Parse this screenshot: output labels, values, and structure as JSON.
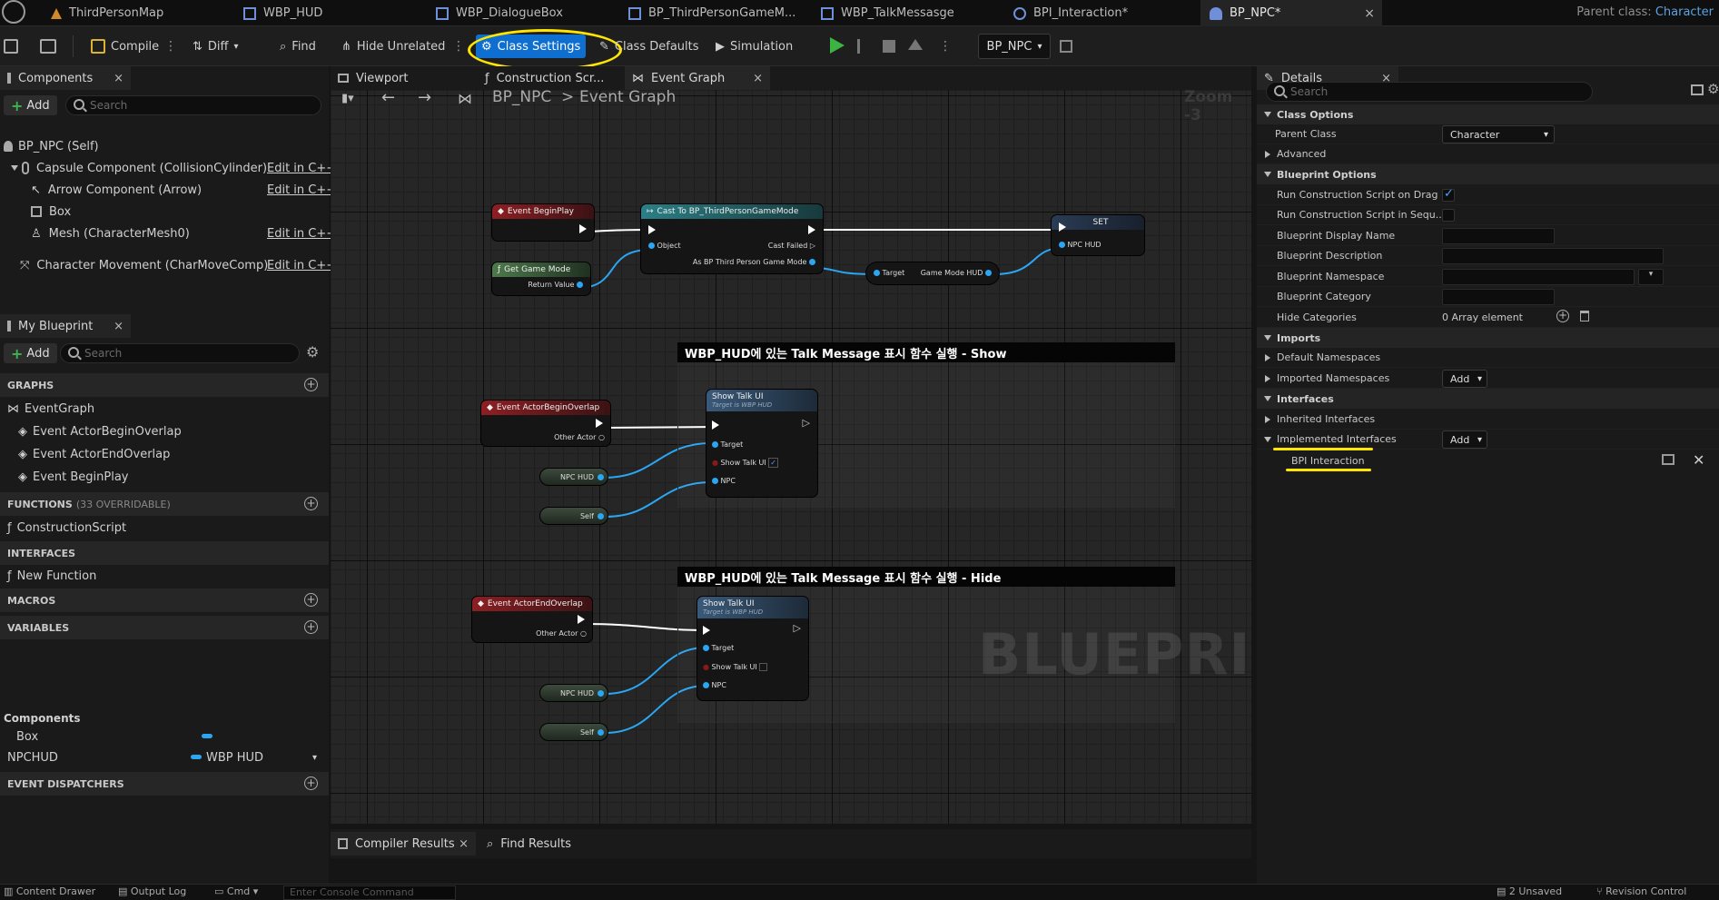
{
  "doc_tabs": [
    {
      "label": "ThirdPersonMap",
      "icon": "level-icon"
    },
    {
      "label": "WBP_HUD",
      "icon": "widget-blueprint-icon"
    },
    {
      "label": "WBP_DialogueBox",
      "icon": "widget-blueprint-icon"
    },
    {
      "label": "BP_ThirdPersonGameM...",
      "icon": "blueprint-icon"
    },
    {
      "label": "WBP_TalkMessasge",
      "icon": "widget-blueprint-icon"
    },
    {
      "label": "BPI_Interaction*",
      "icon": "interface-icon"
    },
    {
      "label": "BP_NPC*",
      "icon": "character-blueprint-icon",
      "active": true,
      "close": "×"
    }
  ],
  "parent_class": {
    "label": "Parent class:",
    "value": "Character"
  },
  "toolbar": {
    "compile": "Compile",
    "diff": "Diff",
    "find": "Find",
    "hide_unrelated": "Hide Unrelated",
    "class_settings": "Class Settings",
    "class_defaults": "Class Defaults",
    "simulation": "Simulation",
    "debug_object": "BP_NPC"
  },
  "components_panel": {
    "title": "Components",
    "close": "×",
    "add": "Add",
    "search_placeholder": "Search",
    "items": [
      {
        "label": "BP_NPC (Self)",
        "edit": ""
      },
      {
        "label": "Capsule Component (CollisionCylinder)",
        "edit": "Edit in C++"
      },
      {
        "label": "Arrow Component (Arrow)",
        "edit": "Edit in C++"
      },
      {
        "label": "Box",
        "edit": ""
      },
      {
        "label": "Mesh (CharacterMesh0)",
        "edit": "Edit in C++"
      },
      {
        "label": "Character Movement (CharMoveComp)",
        "edit": "Edit in C++"
      }
    ]
  },
  "my_blueprint": {
    "title": "My Blueprint",
    "close": "×",
    "add": "Add",
    "search_placeholder": "Search",
    "graphs_header": "GRAPHS",
    "graphs": [
      "EventGraph",
      "Event ActorBeginOverlap",
      "Event ActorEndOverlap",
      "Event BeginPlay"
    ],
    "functions_header": "FUNCTIONS",
    "functions_sub": "(33 OVERRIDABLE)",
    "functions": [
      "ConstructionScript"
    ],
    "interfaces_header": "INTERFACES",
    "interfaces": [
      "New Function"
    ],
    "macros_header": "MACROS",
    "variables_header": "VARIABLES",
    "variables_group": "Components",
    "variables": [
      {
        "name": "Box",
        "type": ""
      },
      {
        "name": "NPCHUD",
        "type": "WBP HUD"
      }
    ],
    "dispatchers_header": "EVENT DISPATCHERS"
  },
  "graph_tabs": {
    "viewport": "Viewport",
    "construction": "Construction Scr...",
    "event_graph": "Event Graph",
    "close": "×"
  },
  "breadcrumb": {
    "root": "BP_NPC",
    "sep": ">",
    "current": "Event Graph",
    "zoom": "Zoom -3"
  },
  "nodes": {
    "begin_play": "Event BeginPlay",
    "cast": "Cast To BP_ThirdPersonGameMode",
    "cast_object": "Object",
    "cast_failed": "Cast Failed",
    "cast_as": "As BP Third Person Game Mode",
    "get_game_mode": "Get Game Mode",
    "return_value": "Return Value",
    "target": "Target",
    "game_mode_hud": "Game Mode HUD",
    "set": "SET",
    "npc_hud": "NPC HUD",
    "comment_show": "WBP_HUD에 있는 Talk Message 표시 함수 실행 - Show",
    "comment_hide": "WBP_HUD에 있는 Talk Message 표시 함수 실행 - Hide",
    "begin_overlap": "Event ActorBeginOverlap",
    "end_overlap": "Event ActorEndOverlap",
    "other_actor": "Other Actor",
    "show_talk_ui": "Show Talk UI",
    "target_is": "Target is WBP HUD",
    "show_talk_ui_pin": "Show Talk UI",
    "npc": "NPC",
    "self": "Self"
  },
  "watermark": "BLUEPRINT",
  "bottom_tabs": {
    "compiler_results": "Compiler Results",
    "close": "×",
    "find_results": "Find Results"
  },
  "details": {
    "title": "Details",
    "close": "×",
    "search_placeholder": "Search",
    "class_options": "Class Options",
    "parent_class_label": "Parent Class",
    "parent_class_value": "Character",
    "advanced": "Advanced",
    "blueprint_options": "Blueprint Options",
    "run_on_drag": "Run Construction Script on Drag",
    "run_on_drag_checked": true,
    "run_in_seq": "Run Construction Script in Sequ...",
    "run_in_seq_checked": false,
    "display_name": "Blueprint Display Name",
    "description": "Blueprint Description",
    "namespace": "Blueprint Namespace",
    "category": "Blueprint Category",
    "hide_categories": "Hide Categories",
    "hide_categories_value": "0 Array element",
    "imports": "Imports",
    "default_namespaces": "Default Namespaces",
    "imported_namespaces": "Imported Namespaces",
    "add": "Add",
    "interfaces": "Interfaces",
    "inherited": "Inherited Interfaces",
    "implemented": "Implemented Interfaces",
    "bpi_entry": "BPI Interaction"
  },
  "statusbar": {
    "content_drawer": "Content Drawer",
    "output_log": "Output Log",
    "cmd": "Cmd",
    "console_placeholder": "Enter Console Command",
    "unsaved": "2 Unsaved",
    "revision": "Revision Control"
  },
  "colors": {
    "accent": "#0f6fd1",
    "highlight": "#ffe600",
    "pin_blue": "#2aa6f2",
    "event_red": "#a3262c"
  }
}
